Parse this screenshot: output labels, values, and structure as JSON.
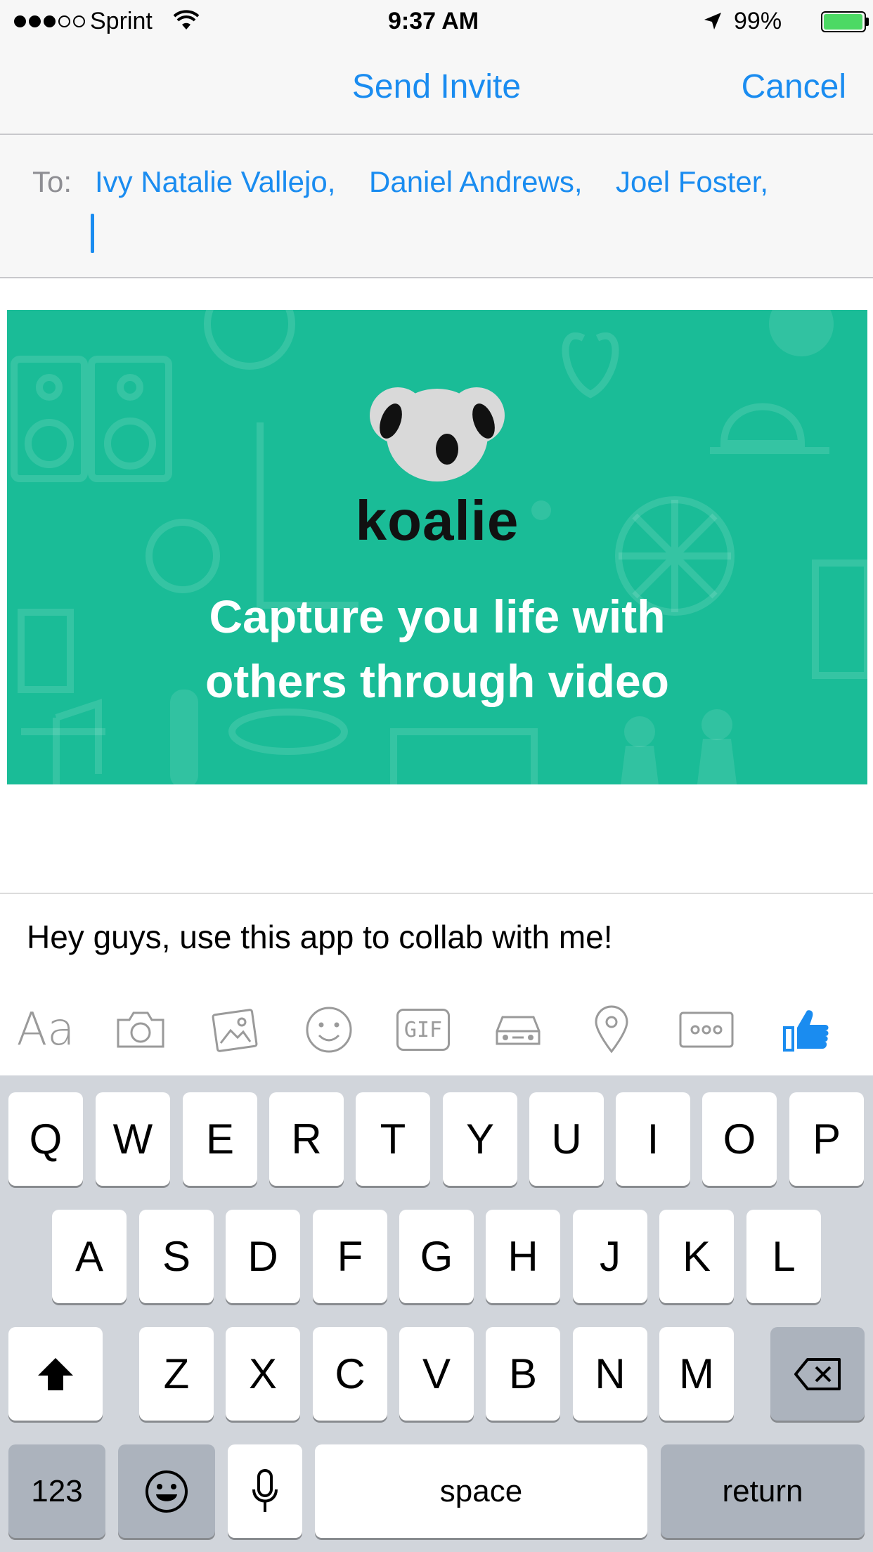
{
  "status_bar": {
    "carrier": "Sprint",
    "time": "9:37 AM",
    "battery_percent": "99%",
    "battery_level": 0.99,
    "signal_bars_filled": 3,
    "signal_bars_total": 5
  },
  "nav": {
    "title": "Send Invite",
    "cancel_label": "Cancel"
  },
  "to_field": {
    "label": "To:",
    "recipients": [
      "Ivy Natalie Vallejo,",
      "Daniel Andrews,",
      "Joel Foster,"
    ]
  },
  "banner": {
    "brand": "koalie",
    "tagline_line1": "Capture you life with",
    "tagline_line2": "others through video"
  },
  "message": {
    "text": "Hey guys, use this app to collab with me!"
  },
  "toolbar": {
    "items": [
      "text-format-icon",
      "camera-icon",
      "photo-library-icon",
      "emoji-icon",
      "gif-icon",
      "car-icon",
      "location-pin-icon",
      "more-icon",
      "thumbs-up-icon"
    ],
    "text_format_label": "Aa",
    "gif_label": "GIF"
  },
  "keyboard": {
    "row1": [
      "Q",
      "W",
      "E",
      "R",
      "T",
      "Y",
      "U",
      "I",
      "O",
      "P"
    ],
    "row2": [
      "A",
      "S",
      "D",
      "F",
      "G",
      "H",
      "J",
      "K",
      "L"
    ],
    "row3": [
      "Z",
      "X",
      "C",
      "V",
      "B",
      "N",
      "M"
    ],
    "numbers_label": "123",
    "space_label": "space",
    "return_label": "return"
  },
  "colors": {
    "accent": "#1a8cf0",
    "banner_bg": "#1abc97",
    "keyboard_bg": "#d1d5db"
  }
}
